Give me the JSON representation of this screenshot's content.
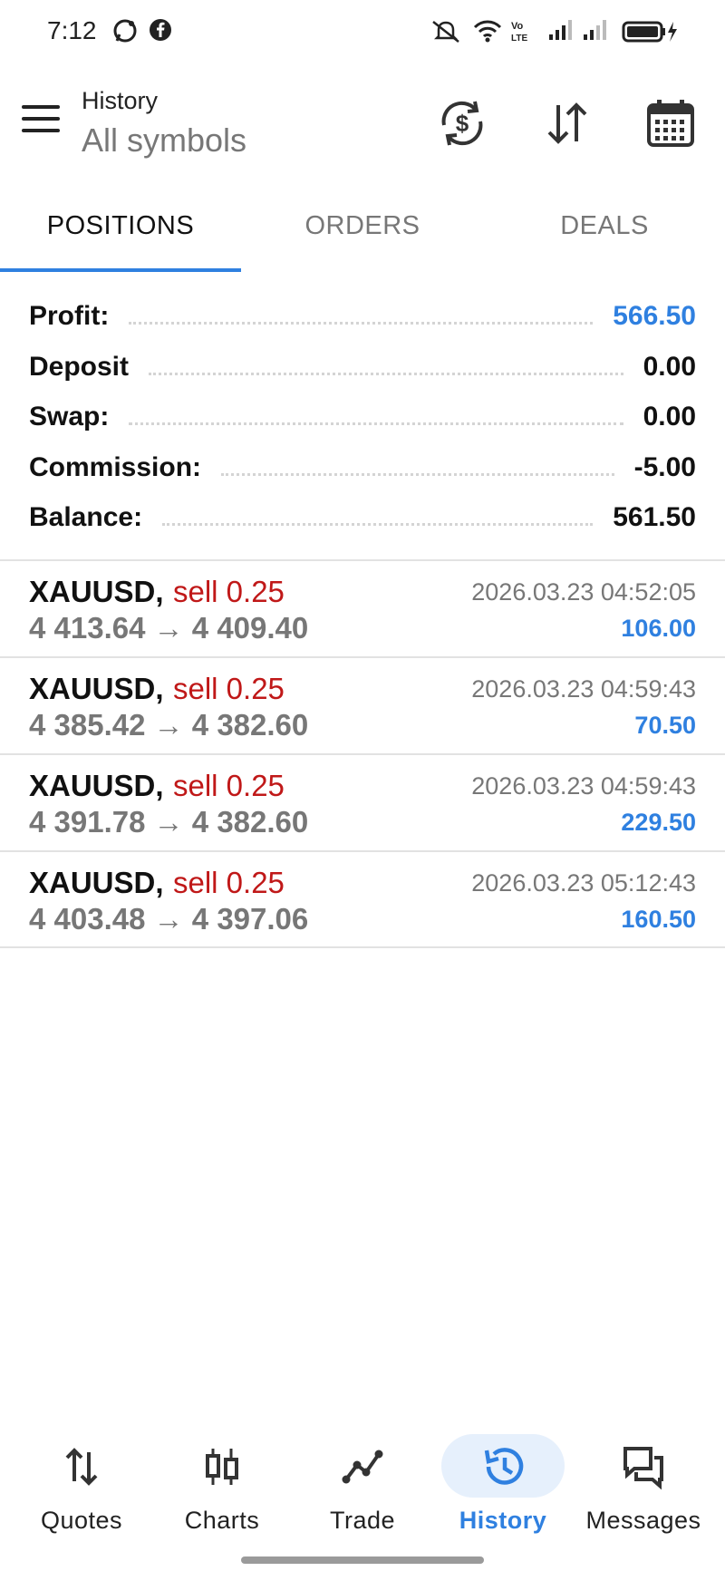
{
  "status_bar": {
    "time": "7:12",
    "icons": [
      "whatsapp-icon",
      "facebook-icon",
      "mute-icon",
      "wifi-icon",
      "volte-icon",
      "signal-icon",
      "signal-icon",
      "battery-icon"
    ]
  },
  "header": {
    "title": "History",
    "subtitle": "All symbols",
    "actions": [
      "refresh-currency-icon",
      "sort-icon",
      "calendar-icon"
    ]
  },
  "tabs": [
    {
      "label": "POSITIONS",
      "active": true
    },
    {
      "label": "ORDERS",
      "active": false
    },
    {
      "label": "DEALS",
      "active": false
    }
  ],
  "summary": [
    {
      "label": "Profit:",
      "value": "566.50",
      "highlight": true
    },
    {
      "label": "Deposit",
      "value": "0.00",
      "highlight": false
    },
    {
      "label": "Swap:",
      "value": "0.00",
      "highlight": false
    },
    {
      "label": "Commission:",
      "value": "-5.00",
      "highlight": false
    },
    {
      "label": "Balance:",
      "value": "561.50",
      "highlight": false
    }
  ],
  "positions": [
    {
      "symbol": "XAUUSD,",
      "side": "sell 0.25",
      "prices": "4 413.64 → 4 409.40",
      "time": "2026.03.23 04:52:05",
      "profit": "106.00"
    },
    {
      "symbol": "XAUUSD,",
      "side": "sell 0.25",
      "prices": "4 385.42 → 4 382.60",
      "time": "2026.03.23 04:59:43",
      "profit": "70.50"
    },
    {
      "symbol": "XAUUSD,",
      "side": "sell 0.25",
      "prices": "4 391.78 → 4 382.60",
      "time": "2026.03.23 04:59:43",
      "profit": "229.50"
    },
    {
      "symbol": "XAUUSD,",
      "side": "sell 0.25",
      "prices": "4 403.48 → 4 397.06",
      "time": "2026.03.23 05:12:43",
      "profit": "160.50"
    }
  ],
  "bottom_nav": [
    {
      "label": "Quotes",
      "icon": "quotes-icon",
      "active": false
    },
    {
      "label": "Charts",
      "icon": "candles-icon",
      "active": false
    },
    {
      "label": "Trade",
      "icon": "trade-icon",
      "active": false
    },
    {
      "label": "History",
      "icon": "history-icon",
      "active": true
    },
    {
      "label": "Messages",
      "icon": "messages-icon",
      "active": false
    }
  ],
  "colors": {
    "accent": "#2f80e0",
    "sell": "#c01818",
    "muted": "#777777"
  }
}
